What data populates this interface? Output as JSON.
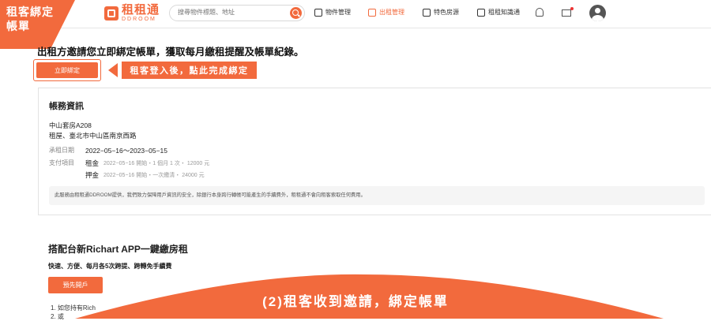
{
  "overlay": {
    "corner_label": "租客綁定\n帳單",
    "callout": "租客登入後，點此完成綁定",
    "bottom_banner": "(2)租客收到邀請，綁定帳單",
    "accent_color": "#f26a3d"
  },
  "header": {
    "logo_cn": "租租通",
    "logo_en": "DDROOM",
    "search_placeholder": "搜尋物件標題、地址",
    "nav": [
      {
        "label": "物件管理",
        "icon": "house-icon",
        "active": false
      },
      {
        "label": "出租管理",
        "icon": "document-icon",
        "active": true
      },
      {
        "label": "特色房源",
        "icon": "star-house-icon",
        "active": false
      },
      {
        "label": "租租知識通",
        "icon": "book-icon",
        "active": false
      }
    ],
    "icons": [
      "bell-icon",
      "mail-icon",
      "avatar"
    ]
  },
  "main": {
    "headline": "出租方邀請您立即綁定帳單，獲取每月繳租提醒及帳單紀錄。",
    "bind_button": "立即綁定",
    "billing": {
      "title": "帳務資訊",
      "property_name": "中山套房A208",
      "property_address": "租屋、臺北市中山區南京西路",
      "lease_label": "承租日期",
      "lease_value": "2022−05−16～2023−05−15",
      "payment_label": "支付項目",
      "rent_label": "租金",
      "rent_detail": "2022−05−16 開始・1 個月 1 次・ 12000 元",
      "deposit_label": "押金",
      "deposit_detail": "2022−05−16 開始・一次繳清・ 24000 元",
      "notice": "此服務由租租通DDROOM提供，我們致力保障用戶資訊的安全，除銀行本身跨行轉帳可能產生的手續費外，租租通不會向租客索取任何費用。"
    },
    "richart": {
      "title": "搭配台新Richart APP一鍵繳房租",
      "subtitle": "快速、方便、每月各5次跨提、跨轉免手續費",
      "button": "預先開戶",
      "item1": "1. 如您持有Rich",
      "item2": "2. 或"
    }
  }
}
